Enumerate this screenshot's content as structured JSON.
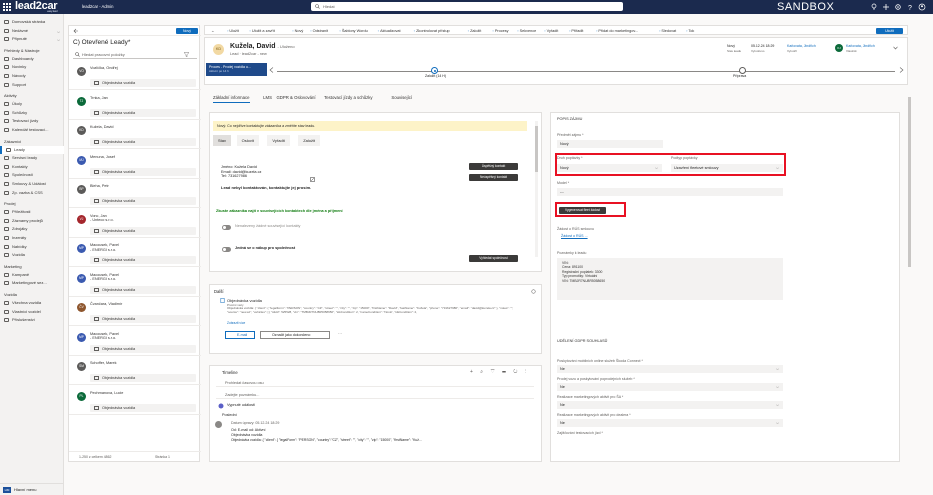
{
  "topbar": {
    "logo": "lead2car",
    "logo_tag": "easy lead",
    "app_name": "lead2car - Admin",
    "search_placeholder": "Hledat",
    "environment": "SANDBOX",
    "icons": [
      "lightbulb-icon",
      "plus-icon",
      "gear-icon",
      "help-icon",
      "user-icon"
    ]
  },
  "nav": {
    "items": [
      {
        "label": "Domovská stránka",
        "type": "item"
      },
      {
        "label": "Nedávné",
        "type": "item",
        "chevron": true
      },
      {
        "label": "Připnuté",
        "type": "item",
        "chevron": true
      },
      {
        "label": "Přehledy & Nástroje",
        "type": "header"
      },
      {
        "label": "Dashboardy",
        "type": "item"
      },
      {
        "label": "Novinky",
        "type": "item"
      },
      {
        "label": "Návody",
        "type": "item"
      },
      {
        "label": "Support",
        "type": "item"
      },
      {
        "label": "Aktivity",
        "type": "header"
      },
      {
        "label": "Úkoly",
        "type": "item"
      },
      {
        "label": "Schůzky",
        "type": "item"
      },
      {
        "label": "Testovací jízdy",
        "type": "item"
      },
      {
        "label": "Kalendář testovací...",
        "type": "item"
      },
      {
        "label": "Zákazníci",
        "type": "header"
      },
      {
        "label": "Leady",
        "type": "item",
        "selected": true
      },
      {
        "label": "Servisní leady",
        "type": "item"
      },
      {
        "label": "Kontakty",
        "type": "item"
      },
      {
        "label": "Společnosti",
        "type": "item"
      },
      {
        "label": "Smlouvy & Událost",
        "type": "item"
      },
      {
        "label": "Zp. vazba & CSS",
        "type": "item"
      },
      {
        "label": "Prodej",
        "type": "header"
      },
      {
        "label": "Příležitosti",
        "type": "item"
      },
      {
        "label": "Záznamy prodejů",
        "type": "item"
      },
      {
        "label": "Zdrojáky",
        "type": "item"
      },
      {
        "label": "Inzeráty",
        "type": "item"
      },
      {
        "label": "Nabídky",
        "type": "item"
      },
      {
        "label": "Vozidla",
        "type": "item"
      },
      {
        "label": "Marketing",
        "type": "header"
      },
      {
        "label": "Kampaně",
        "type": "item"
      },
      {
        "label": "Marketingové sez...",
        "type": "item"
      },
      {
        "label": "Vozidla",
        "type": "header"
      },
      {
        "label": "Všechna vozidla",
        "type": "item"
      },
      {
        "label": "Vlastníci vozidel",
        "type": "item"
      },
      {
        "label": "Příslušenství",
        "type": "item"
      }
    ],
    "area_switch": "Hlavní menu",
    "area_switch_badge": "HM"
  },
  "list": {
    "new_label": "Nový",
    "view_title": "C) Otevřené Leady*",
    "search_placeholder": "Hledat pracovní položky",
    "rows": [
      {
        "name": "Vozlíčka, Ondřej",
        "sub": "",
        "rec": "Objednávka vozidla",
        "initials": "VO",
        "color": "#5b5a59"
      },
      {
        "name": "Trnka, Jan",
        "sub": "",
        "rec": "Objednávka vozidla",
        "initials": "TJ",
        "color": "#0b6a3a"
      },
      {
        "name": "Kuželа, David",
        "sub": "",
        "rec": "Objednávka vozidla",
        "initials": "KD",
        "color": "#5b5a59"
      },
      {
        "name": "Menuna, Josef",
        "sub": "",
        "rec": "Objednávka vozidla",
        "initials": "MJ",
        "color": "#3b5ab0"
      },
      {
        "name": "Bleha, Petr",
        "sub": "",
        "rec": "Objednávka vozidla",
        "initials": "BP",
        "color": "#5b5a59"
      },
      {
        "name": "Vonc, Jan",
        "sub": "- Unteco s.r.o.",
        "rec": "Objednávka vozidla",
        "initials": "VJ",
        "color": "#a4262c"
      },
      {
        "name": "Macousek, Pavel",
        "sub": "- ENERGI s.r.o.",
        "rec": "Objednávka vozidla",
        "initials": "MP",
        "color": "#3b5ab0"
      },
      {
        "name": "Macousek, Pavel",
        "sub": "- ENERGI s.r.o.",
        "rec": "Objednávka vozidla",
        "initials": "MP",
        "color": "#3b5ab0"
      },
      {
        "name": "Čvančara, Vladimír",
        "sub": "",
        "rec": "Objednávka vozidla",
        "initials": "ČV",
        "color": "#8e562e"
      },
      {
        "name": "Macousek, Pavel",
        "sub": "- ENERGI s.r.o.",
        "rec": "Objednávka vozidla",
        "initials": "MP",
        "color": "#3b5ab0"
      },
      {
        "name": "Schoffer, Marek",
        "sub": "",
        "rec": "Objednávka vozidla",
        "initials": "SM",
        "color": "#5b5a59"
      },
      {
        "name": "Pechmanova, Lucie",
        "sub": "",
        "rec": "Objednávka vozidla",
        "initials": "PL",
        "color": "#0b6a3a"
      }
    ],
    "footer": "1-250 z celkem 4862",
    "page": "Stránka 1"
  },
  "commands": [
    "Uložit",
    "Uložit a zavřít",
    "Nový",
    "Odstranit",
    "Šablony Wordu",
    "Aktualizovat",
    "Zkontrolovat přístup",
    "Založit",
    "Procesy",
    "Sekvence",
    "Vyřadit",
    "Přiřadit",
    "Přidat do marketingov...",
    "Sledovat",
    "Tok"
  ],
  "save_label": "Uložit",
  "record": {
    "initials": "KD",
    "name": "Kužela, David",
    "suffix": "- Uloženo",
    "subtitle": "Lead · lead2car - new",
    "status_label": "Stav leadu",
    "status_value": "Nový",
    "date_value": "05.12.24 18:29",
    "date_label": "Vytvořeno",
    "owner_value": "Kaňovata, Jindřich",
    "owner_label": "Vytvořil",
    "owner2_value": "Kaňovata, Jindřich",
    "owner2_label": "Vlastník",
    "owner2_initials": "KJ"
  },
  "bpf": {
    "stage_title": "Proces - Prodej vozidla u...",
    "stage_sub": "Aktivní po 14 h",
    "step1": "Založit (14 H)",
    "step2": "Příprava"
  },
  "tabs": [
    "Základní informace",
    "LMS",
    "GDPR & Oslovování",
    "Testovací jízdy a schůzky",
    "Související"
  ],
  "process": {
    "warning": "Nový: Co nejdříve kontaktujte zákazníka a změňte stav leadu.",
    "subtabs": [
      "Stav",
      "Oslovit",
      "Vyřadit",
      "Založit"
    ],
    "contact_lines": [
      "Jméno: Kužela David",
      "Email: david@kuzela.cz",
      "Tel:    731627986"
    ],
    "not_contacted": "Lead nebyl kontaktován, kontaktujte jej prosím.",
    "btn_success": "Úspěšný kontakt",
    "btn_fail": "Neúspěšný kontakt",
    "green_info": "Zkuste zákazníka najít v souvisejících kontaktech dle jména a příjmení",
    "toggle1": "Nenalezeny žádné související kontakty",
    "toggle2": "Jedná se o nákup pro společnost",
    "btn_company": "Vyhledat společnost"
  },
  "dalsi": {
    "title": "Další",
    "item_title": "Objednávka vozidla",
    "item_sub": "Prvotní vazy",
    "item_json": "Objednávka vozidla: { \"client\": { \"legalForm\": \"PERSON\", \"country\": \"CZ\", \"street\": \"\", \"city\": \"\", \"zip\": \"15000\", \"firstName\": \"David\", \"lastName\": \"Kužela\", \"phone\": \"731627986\", \"email\": \"david@kuzela.cz\" }, \"notes\": \"\", \"source\": \"new.az\", \"vehicles\": [ { \"stkId\": 525528, \"vin\": \"TMBJR7NU8R5058650\", \"stkCondition\": 2, \"nameCondition\": \"Nová\", \"stkCondition\": 2,",
    "show_more": "Zobrazit více",
    "btn_email": "E-mail",
    "btn_done": "Označit jako dokončeno"
  },
  "timeline": {
    "title": "Timeline",
    "search_placeholder": "Prohledat časovou osu",
    "note_placeholder": "Zadejte poznámku...",
    "pinned": "Vypnuté události",
    "recent": "Poslední",
    "item_date": "Datum úpravy: 05.12.24 18:29",
    "item_title": "Objednávka vozidla",
    "item_from": "Od: E-mail od:  Aktivní",
    "item_text": "Objednávka vozidla: { \"client\": { \"legalForm\": \"PERSON\", \"country\":\"CZ\", \"street\": \"\", \"city\": \"\", \"zip\": \"15000\", \"firstName\": \"Kuž..."
  },
  "detail": {
    "section": "POPIS ZÁJMU",
    "subject_label": "Předmět zájmu *",
    "subject_value": "Nový",
    "type_label": "Druh poptávky *",
    "type_value": "Nový",
    "subtype_label": "Podtyp poptávky",
    "subtype_value": "Uzavření fleetové smlouvy",
    "model_label": "Model *",
    "model_value": "---",
    "generate_btn": "Vygenerovat fleet žádost",
    "rz_label": "Žádost o RÚS smlouvu",
    "rz_value": "Žádost o RÚS ...",
    "notes_label": "Poznámky k leadu",
    "notes_lines": [
      "VIN:",
      "Cena: 891100",
      "Registrační poplatek: 3300",
      "Typ promotiky: Virtuální",
      "VIN: TMBJR7NU8R5058650"
    ],
    "gdpr_section": "UDĚLENÍ GDPR SOUHLASŮ",
    "consents": [
      {
        "label": "Poskytování mobilních online služeb Škoda Connect *",
        "value": "Ne"
      },
      {
        "label": "Prodej vozu a poskytování poprodejních služeb *",
        "value": "Ne"
      },
      {
        "label": "Realizace marketingových aktivit pro ŠA *",
        "value": "Ne"
      },
      {
        "label": "Realizace marketingových aktivit pro dealera *",
        "value": "Ne"
      },
      {
        "label": "Zajišťování testovacích jízd *",
        "value": ""
      }
    ]
  }
}
